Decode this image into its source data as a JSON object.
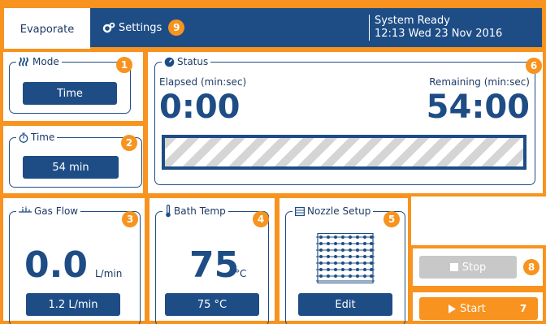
{
  "header": {
    "tab_evaporate": "Evaporate",
    "settings_label": "Settings",
    "settings_badge": "9",
    "status_line1": "System Ready",
    "status_line2": "12:13 Wed 23 Nov 2016"
  },
  "mode": {
    "legend": "Mode",
    "button": "Time",
    "badge": "1"
  },
  "time": {
    "legend": "Time",
    "button": "54 min",
    "badge": "2"
  },
  "status": {
    "legend": "Status",
    "elapsed_label": "Elapsed (min:sec)",
    "elapsed_value": "0:00",
    "remaining_label": "Remaining (min:sec)",
    "remaining_value": "54:00",
    "progress_fraction": 0,
    "badge": "6"
  },
  "gas_flow": {
    "legend": "Gas Flow",
    "value": "0.0",
    "unit": "L/min",
    "button": "1.2 L/min",
    "badge": "3"
  },
  "bath_temp": {
    "legend": "Bath Temp",
    "value": "75",
    "unit": "°C",
    "button": "75 °C",
    "badge": "4"
  },
  "nozzle_setup": {
    "legend": "Nozzle Setup",
    "button": "Edit",
    "badge": "5"
  },
  "controls": {
    "stop_label": "Stop",
    "stop_badge": "8",
    "start_label": "Start",
    "start_badge": "7"
  },
  "colors": {
    "accent": "#f7931e",
    "primary": "#1e4d86",
    "disabled": "#c8c8c8"
  }
}
